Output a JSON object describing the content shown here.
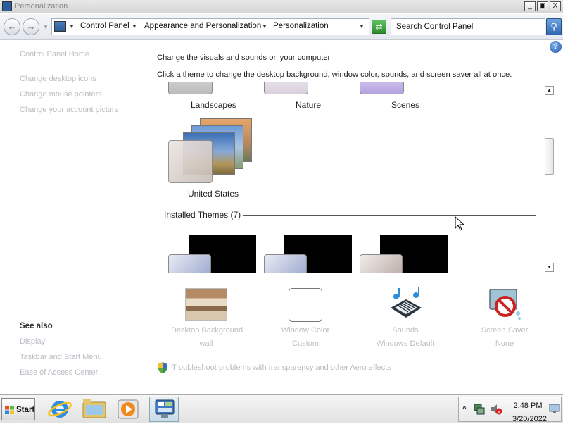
{
  "window": {
    "title": "Personalization",
    "controls": {
      "minimize": "_",
      "maximize": "▣",
      "close": "X"
    }
  },
  "address": {
    "breadcrumbs": [
      "Control Panel",
      "Appearance and Personalization",
      "Personalization"
    ],
    "search_placeholder": "Search Control Panel"
  },
  "sidebar": {
    "home": "Control Panel Home",
    "tasks": [
      "Change desktop icons",
      "Change mouse pointers",
      "Change your account picture"
    ],
    "see_also_title": "See also",
    "see_also": [
      "Display",
      "Taskbar and Start Menu",
      "Ease of Access Center"
    ]
  },
  "main": {
    "heading": "Change the visuals and sounds on your computer",
    "subheading": "Click a theme to change the desktop background, window color, sounds, and screen saver all at once.",
    "aero_themes": [
      "Landscapes",
      "Nature",
      "Scenes",
      "United States"
    ],
    "installed_section": "Installed Themes (7)"
  },
  "tiles": [
    {
      "title": "Desktop Background",
      "value": "wall",
      "icon": "desktop-background-icon"
    },
    {
      "title": "Window Color",
      "value": "Custom",
      "icon": "window-color-icon"
    },
    {
      "title": "Sounds",
      "value": "Windows Default",
      "icon": "sounds-icon"
    },
    {
      "title": "Screen Saver",
      "value": "None",
      "icon": "screen-saver-icon"
    }
  ],
  "troubleshoot": "Troubleshoot problems with transparency and other Aero effects",
  "taskbar": {
    "start": "Start",
    "time": "2:48 PM",
    "date": "3/20/2022"
  },
  "colors": {
    "link_disabled": "#b9bdc3",
    "accent_blue": "#2f68b3"
  }
}
